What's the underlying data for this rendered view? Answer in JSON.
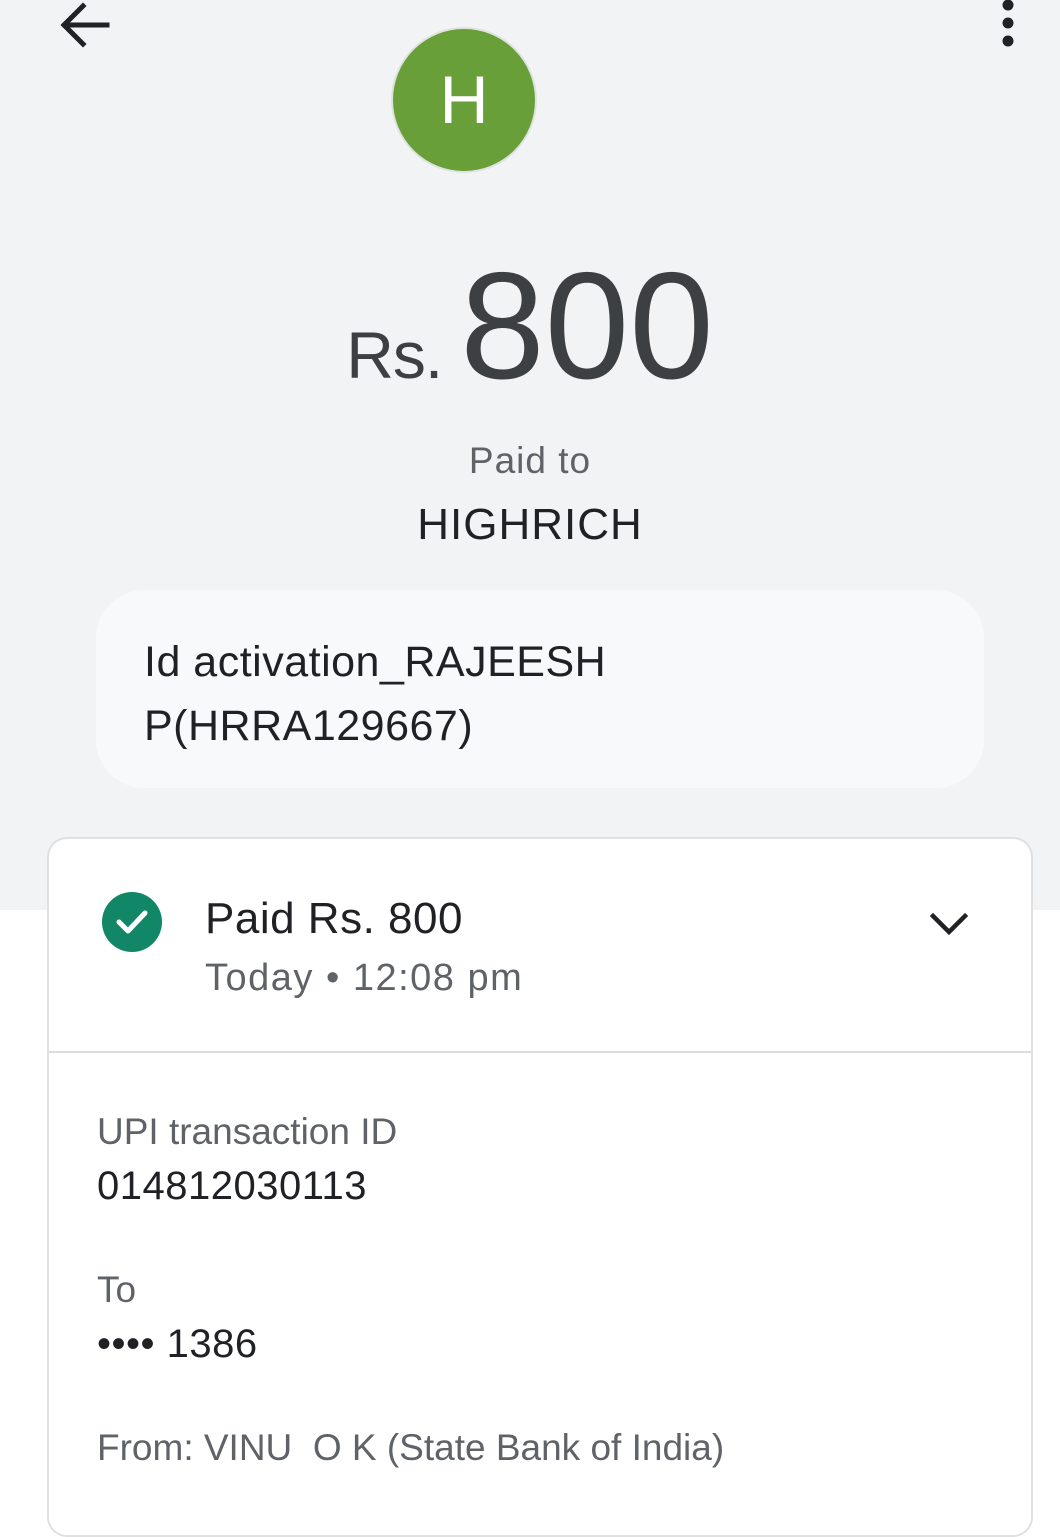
{
  "header": {
    "back_icon": "arrow-back-icon",
    "more_icon": "more-vert-icon"
  },
  "avatar": {
    "initial": "H",
    "color": "#689f38"
  },
  "payment": {
    "currency": "Rs.",
    "amount": "800",
    "paid_to_label": "Paid to",
    "payee": "HIGHRICH",
    "note_line1": "Id activation_RAJEESH",
    "note_line2": "P(HRRA129667)"
  },
  "status": {
    "icon": "check-circle-icon",
    "color": "#128767",
    "title": "Paid Rs. 800",
    "time": "Today • 12:08 pm",
    "expand_icon": "chevron-down-icon"
  },
  "details": {
    "upi_label": "UPI transaction ID",
    "upi_value": "014812030113",
    "to_label": "To",
    "to_value": "•••• 1386",
    "from_line": "From: VINU  O K (State Bank of India)"
  }
}
